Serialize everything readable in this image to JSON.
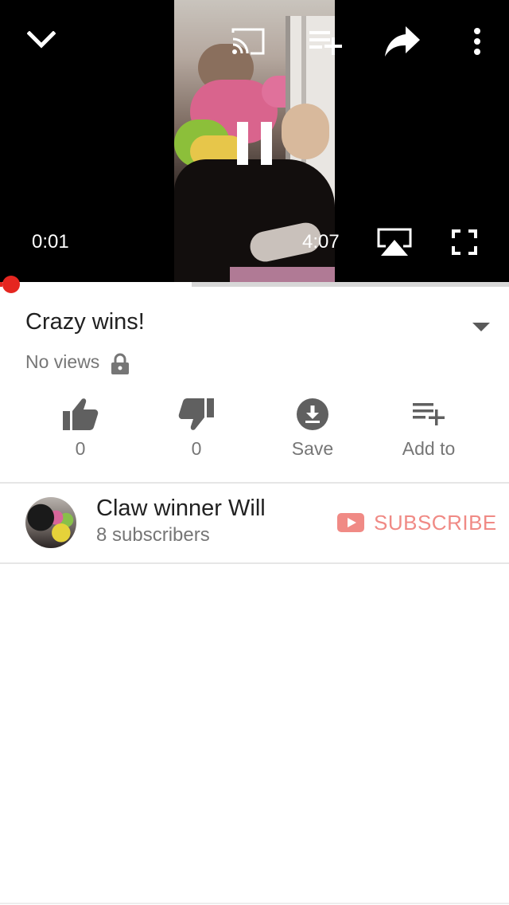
{
  "player": {
    "current_time": "0:01",
    "duration": "4:07",
    "playback_progress_fraction": 0.004,
    "buffered_fraction": 0.377,
    "state": "playing",
    "icons": [
      "chevron-down-icon",
      "cast-icon",
      "add-to-queue-icon",
      "share-icon",
      "more-vert-icon",
      "pause-icon",
      "airplay-icon",
      "fullscreen-icon"
    ]
  },
  "video": {
    "title": "Crazy wins!",
    "views": "No views",
    "privacy_icon": "lock-icon"
  },
  "actions": [
    {
      "name": "like",
      "icon": "thumbs-up-icon",
      "label": "0"
    },
    {
      "name": "dislike",
      "icon": "thumbs-down-icon",
      "label": "0"
    },
    {
      "name": "save",
      "icon": "download-icon",
      "label": "Save"
    },
    {
      "name": "add-to",
      "icon": "playlist-add-icon",
      "label": "Add to"
    }
  ],
  "channel": {
    "name": "Claw winner Will",
    "subscribers": "8 subscribers",
    "subscribe_label": "SUBSCRIBE"
  },
  "colors": {
    "progress_played": "#e52620",
    "subscribe": "#f08a85",
    "icon_gray": "#606060",
    "secondary_text": "#767676",
    "primary_text": "#212121"
  }
}
